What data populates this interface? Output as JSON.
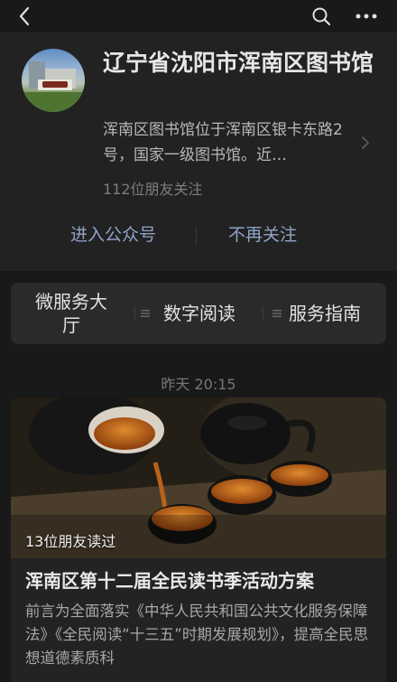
{
  "topbar": {
    "back_icon": "chevron-left-icon",
    "search_icon": "search-icon",
    "more_icon": "more-horizontal-icon"
  },
  "account": {
    "name": "辽宁省沈阳市浑南区图书馆",
    "description": "浑南区图书馆位于浑南区银卡东路2号，国家一级图书馆。近…",
    "followers": "112位朋友关注",
    "enter_label": "进入公众号",
    "unfollow_label": "不再关注"
  },
  "menu": {
    "items": [
      {
        "label": "微服务大厅"
      },
      {
        "label": "数字阅读"
      },
      {
        "label": "服务指南"
      }
    ]
  },
  "feed": {
    "timestamp": "昨天 20:15",
    "article": {
      "read_count": "13位朋友读过",
      "title": "浑南区第十二届全民读书季活动方案",
      "summary": "前言为全面落实《中华人民共和国公共文化服务保障法》《全民阅读“十三五”时期发展规划》，提高全民思想道德素质科"
    }
  },
  "colors": {
    "background": "#191919",
    "card": "#222222",
    "link": "#8fa3c8"
  }
}
